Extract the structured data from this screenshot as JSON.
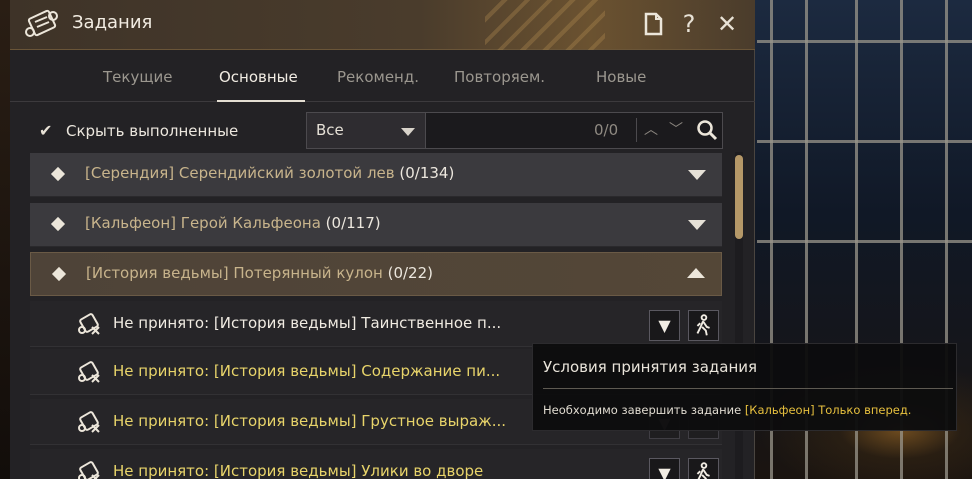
{
  "window": {
    "title": "Задания",
    "buttons": {
      "help": "?",
      "close": "✕"
    }
  },
  "tabs": [
    {
      "label": "Текущие",
      "active": false
    },
    {
      "label": "Основные",
      "active": true
    },
    {
      "label": "Рекоменд.",
      "active": false
    },
    {
      "label": "Повторяем.",
      "active": false
    },
    {
      "label": "Новые",
      "active": false
    }
  ],
  "filter": {
    "hide_completed_label": "Скрыть выполненные",
    "hide_completed_checked": true,
    "select_value": "Все",
    "search_value": "",
    "match_count": "0/0"
  },
  "groups": [
    {
      "region": "[Серендия]",
      "name": "Серендийский золотой лев",
      "count": "(0/134)",
      "expanded": false
    },
    {
      "region": "[Кальфеон]",
      "name": "Герой Кальфеона",
      "count": "(0/117)",
      "expanded": false
    },
    {
      "region": "[История ведьмы]",
      "name": "Потерянный кулон",
      "count": "(0/22)",
      "expanded": true
    }
  ],
  "quests": [
    {
      "text": "Не принято: [История ведьмы] Таинственное п...",
      "status": "normal"
    },
    {
      "text": "Не принято: [История ведьмы] Содержание пи...",
      "status": "locked"
    },
    {
      "text": "Не принято: [История ведьмы] Грустное выраж...",
      "status": "locked"
    },
    {
      "text": "Не принято: [История ведьмы] Улики во дворе",
      "status": "locked"
    }
  ],
  "tooltip": {
    "title": "Условия принятия задания",
    "body_prefix": "Необходимо завершить задание ",
    "body_quest": "[Кальфеон] Только вперед."
  },
  "colors": {
    "accent_gold": "#e7c03e",
    "locked_quest_text": "#e8d46a",
    "region_text": "#c8b48c",
    "scroll_thumb": "#b59868"
  }
}
